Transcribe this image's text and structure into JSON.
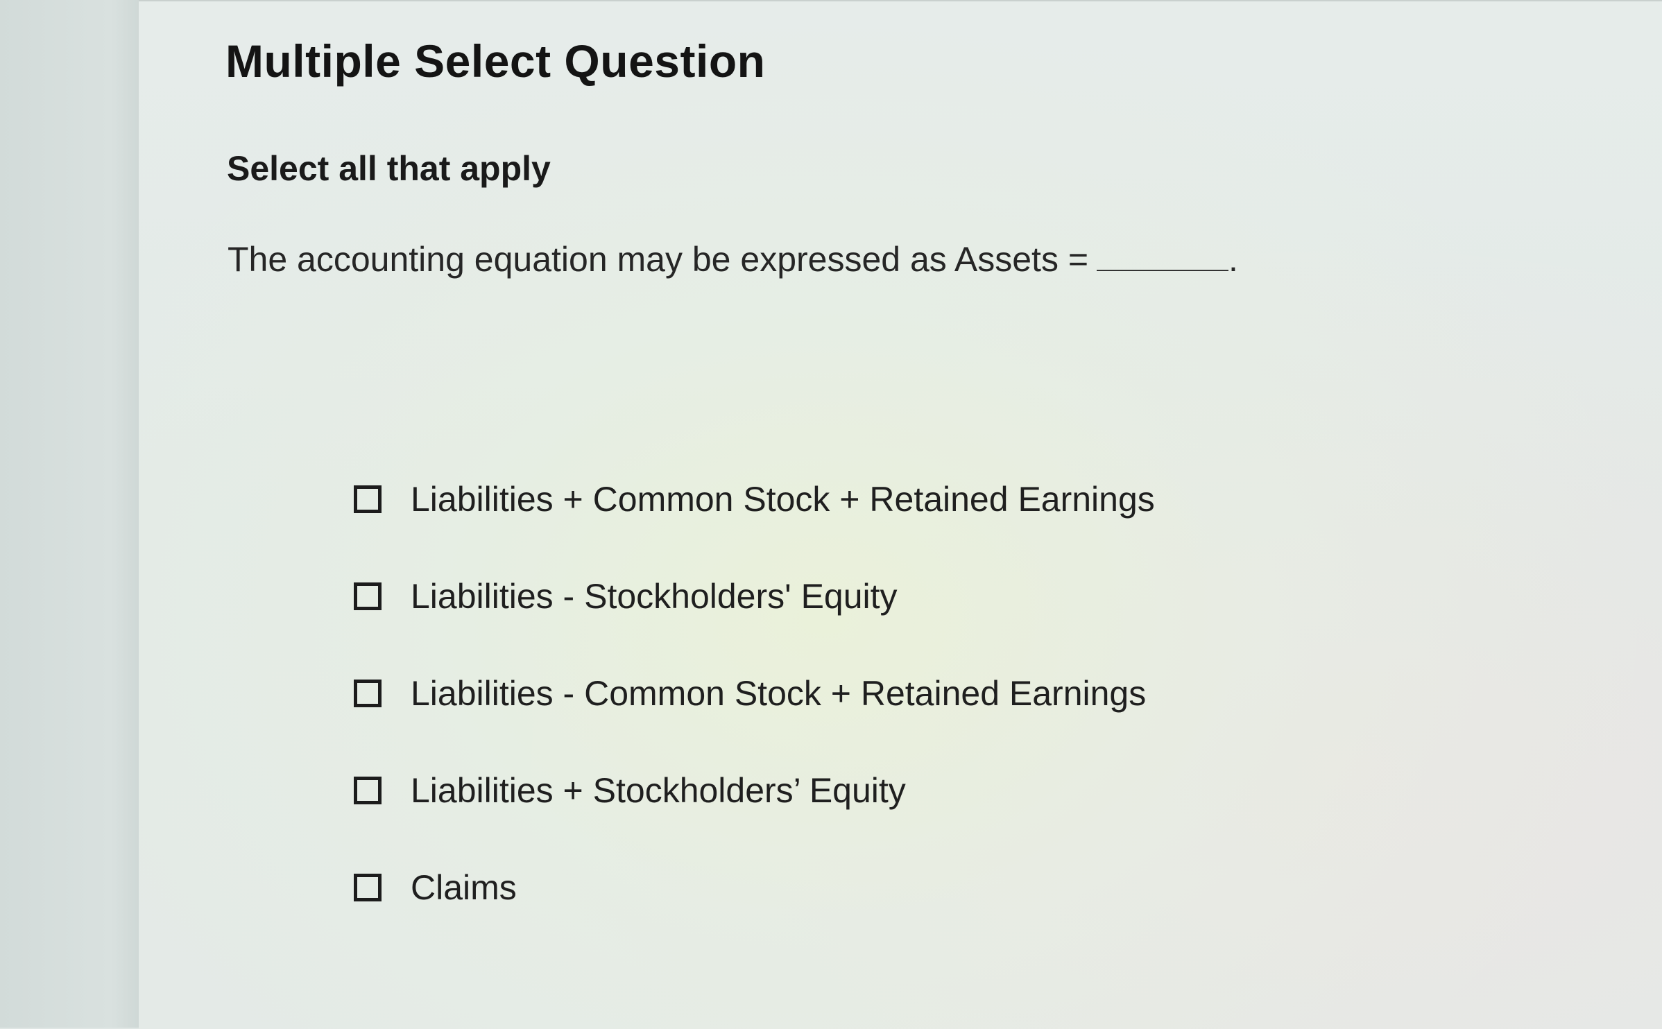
{
  "question": {
    "type_heading": "Multiple Select Question",
    "instruction": "Select all that apply",
    "prompt_text": "The accounting equation may be expressed as Assets =",
    "prompt_suffix": "."
  },
  "options": [
    {
      "label": "Liabilities + Common Stock + Retained Earnings",
      "checked": false
    },
    {
      "label": "Liabilities - Stockholders' Equity",
      "checked": false
    },
    {
      "label": "Liabilities - Common Stock + Retained Earnings",
      "checked": false
    },
    {
      "label": "Liabilities + Stockholders’ Equity",
      "checked": false
    },
    {
      "label": "Claims",
      "checked": false
    }
  ]
}
